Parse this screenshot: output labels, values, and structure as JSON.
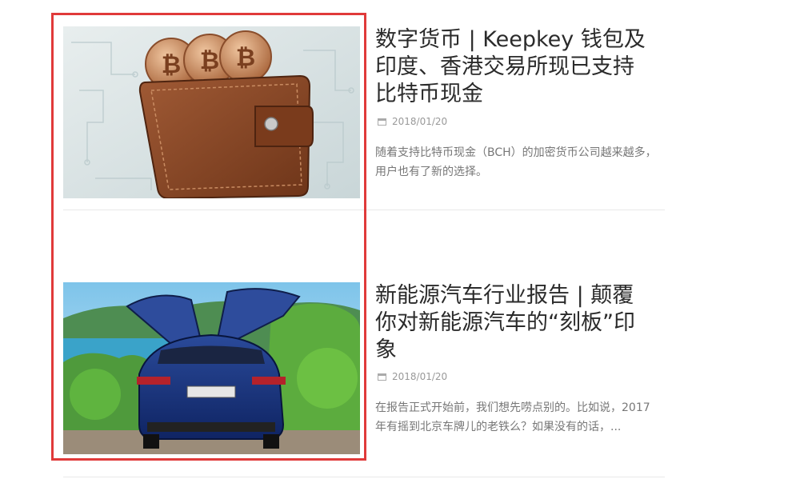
{
  "posts": [
    {
      "title": "数字货币 | Keepkey 钱包及印度、香港交易所现已支持比特币现金",
      "date": "2018/01/20",
      "excerpt": "随着支持比特币现金（BCH）的加密货币公司越来越多，用户也有了新的选择。",
      "image_icon": "wallet-with-bitcoins"
    },
    {
      "title": "新能源汽车行业报告 | 颠覆你对新能源汽车的“刻板”印象",
      "date": "2018/01/20",
      "excerpt": "在报告正式开始前，我们想先唠点别的。比如说，2017年有摇到北京车牌儿的老铁么？如果没有的话，...",
      "image_icon": "blue-suv-with-falcon-doors"
    }
  ],
  "colors": {
    "highlight": "#e03a3a",
    "title": "#2b2b2b",
    "meta": "#999999",
    "excerpt": "#777777"
  }
}
